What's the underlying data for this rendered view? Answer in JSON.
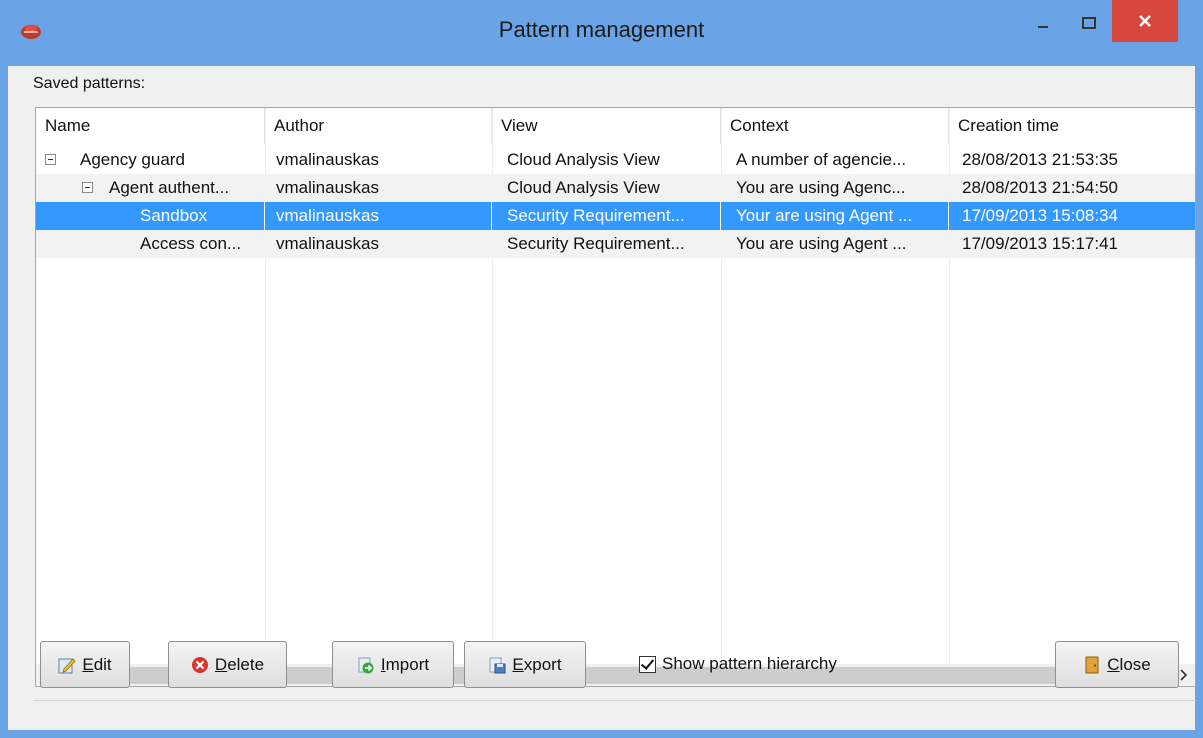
{
  "window": {
    "title": "Pattern management"
  },
  "saved_label": "Saved patterns:",
  "columns": [
    "Name",
    "Author",
    "View",
    "Context",
    "Creation time"
  ],
  "rows": [
    {
      "name": "Agency guard",
      "author": "vmalinauskas",
      "view": "Cloud Analysis View",
      "context": "A number of agencie...",
      "created": "28/08/2013 21:53:35",
      "level": 0,
      "expanded": true,
      "selected": false
    },
    {
      "name": "Agent authent...",
      "author": "vmalinauskas",
      "view": "Cloud Analysis View",
      "context": "You are using Agenc...",
      "created": "28/08/2013 21:54:50",
      "level": 1,
      "expanded": true,
      "selected": false
    },
    {
      "name": "Sandbox",
      "author": "vmalinauskas",
      "view": "Security Requirement...",
      "context": "Your are using Agent ...",
      "created": "17/09/2013 15:08:34",
      "level": 2,
      "selected": true
    },
    {
      "name": "Access con...",
      "author": "vmalinauskas",
      "view": "Security Requirement...",
      "context": "You are using Agent ...",
      "created": "17/09/2013 15:17:41",
      "level": 2,
      "selected": false
    }
  ],
  "buttons": {
    "edit": {
      "mnemonic": "E",
      "rest": "dit"
    },
    "delete": {
      "mnemonic": "D",
      "rest": "elete"
    },
    "import": {
      "mnemonic": "I",
      "rest": "mport"
    },
    "export": {
      "mnemonic": "E",
      "rest": "xport"
    },
    "close": {
      "mnemonic": "C",
      "rest": "lose"
    }
  },
  "show_hierarchy": {
    "label": "Show pattern hierarchy",
    "checked": true
  },
  "colors": {
    "selection": "#3399ff",
    "titlebar": "#6aa3e6",
    "close_button": "#d8473d"
  }
}
